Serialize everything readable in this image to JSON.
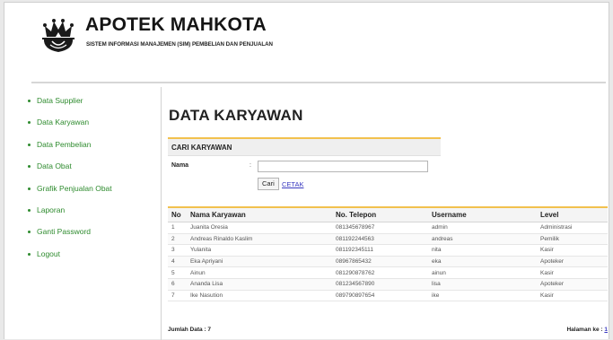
{
  "header": {
    "title": "APOTEK MAHKOTA",
    "subtitle": "SISTEM INFORMASI MANAJEMEN (SIM) PEMBELIAN DAN PENJUALAN"
  },
  "sidebar": {
    "items": [
      {
        "label": "Data Supplier"
      },
      {
        "label": "Data Karyawan"
      },
      {
        "label": "Data Pembelian"
      },
      {
        "label": "Data Obat"
      },
      {
        "label": "Grafik Penjualan Obat"
      },
      {
        "label": "Laporan"
      },
      {
        "label": "Ganti Password"
      },
      {
        "label": "Logout"
      }
    ]
  },
  "main": {
    "page_title": "DATA KARYAWAN",
    "search": {
      "header": "CARI KARYAWAN",
      "label": "Nama",
      "separator": ":",
      "value": "",
      "button": "Cari",
      "print_link": "CETAK"
    },
    "table": {
      "columns": [
        "No",
        "Nama Karyawan",
        "No. Telepon",
        "Username",
        "Level"
      ],
      "rows": [
        [
          "1",
          "Juanita Oresia",
          "081345678967",
          "admin",
          "Administrasi"
        ],
        [
          "2",
          "Andreas Rinaldo Kaslim",
          "081192244563",
          "andreas",
          "Pemilik"
        ],
        [
          "3",
          "Yulanita",
          "081192345111",
          "nita",
          "Kasir"
        ],
        [
          "4",
          "Eka Apriyani",
          "08967865432",
          "eka",
          "Apoteker"
        ],
        [
          "5",
          "Ainun",
          "081290878762",
          "ainun",
          "Kasir"
        ],
        [
          "6",
          "Ananda Lisa",
          "081234567890",
          "lisa",
          "Apoteker"
        ],
        [
          "7",
          "Ike Nasution",
          "089790897654",
          "ike",
          "Kasir"
        ]
      ]
    },
    "footer": {
      "total_label": "Jumlah Data : 7",
      "page_label": "Halaman ke :",
      "page_number": "1"
    }
  },
  "colors": {
    "accent": "#f2c14e",
    "menu_link": "#2e8b2e",
    "link": "#3a3ac0"
  }
}
